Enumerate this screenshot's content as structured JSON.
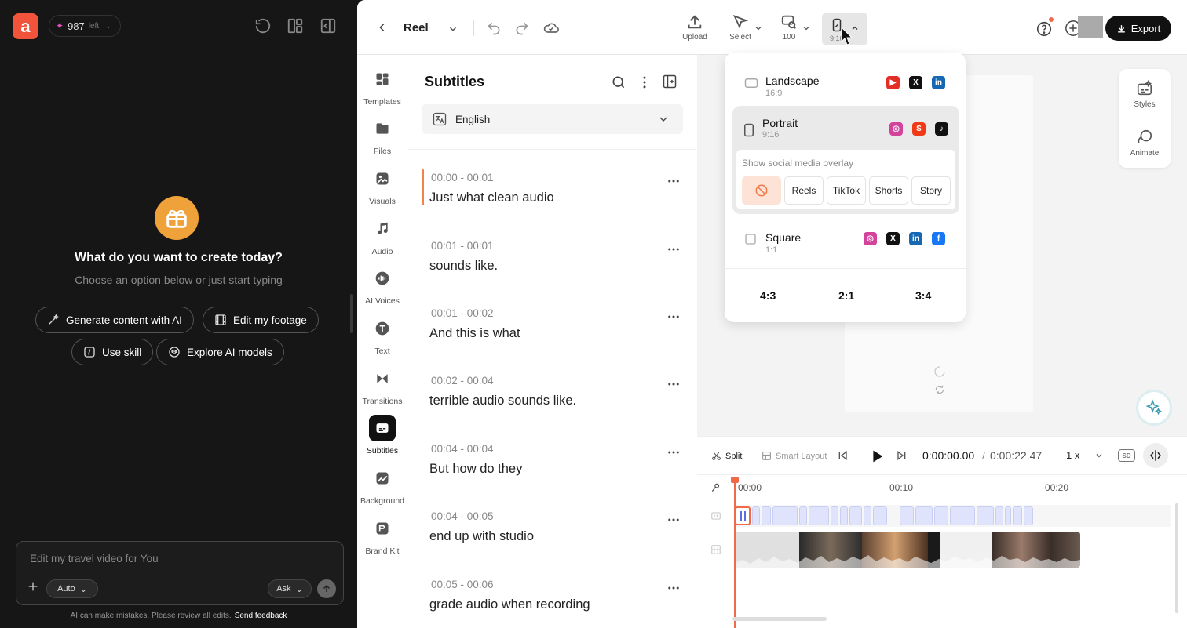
{
  "left_panel": {
    "credits": {
      "count": "987",
      "suffix": "left"
    },
    "hero_title": "What do you want to create today?",
    "hero_subtitle": "Choose an option below or just start typing",
    "actions": [
      "Generate content with AI",
      "Edit my footage",
      "Use skill",
      "Explore AI models"
    ],
    "composer_placeholder": "Edit my travel video for You",
    "mode_label": "Auto",
    "ask_label": "Ask",
    "disclaimer": "AI can make mistakes. Please review all edits.",
    "feedback_link": "Send feedback"
  },
  "topbar": {
    "project_title": "Reel",
    "tools": {
      "upload": "Upload",
      "select": "Select",
      "zoom": "100",
      "ratio": "9:16"
    },
    "export_label": "Export"
  },
  "sidebar": {
    "items": [
      "Templates",
      "Files",
      "Visuals",
      "Audio",
      "AI Voices",
      "Text",
      "Transitions",
      "Subtitles",
      "Background",
      "Brand Kit"
    ],
    "active": "Subtitles"
  },
  "subtitles": {
    "title": "Subtitles",
    "language": "English",
    "entries": [
      {
        "time": "00:00 - 00:01",
        "text": "Just what clean audio"
      },
      {
        "time": "00:01 - 00:01",
        "text": "sounds like."
      },
      {
        "time": "00:01 - 00:02",
        "text": "And this is what"
      },
      {
        "time": "00:02 - 00:04",
        "text": "terrible audio sounds like."
      },
      {
        "time": "00:04 - 00:04",
        "text": "But how do they"
      },
      {
        "time": "00:04 - 00:05",
        "text": "end up with studio"
      },
      {
        "time": "00:05 - 00:06",
        "text": "grade audio when recording"
      }
    ]
  },
  "ratio_menu": {
    "landscape": {
      "name": "Landscape",
      "ratio": "16:9"
    },
    "portrait": {
      "name": "Portrait",
      "ratio": "9:16"
    },
    "overlay_label": "Show social media overlay",
    "overlays": [
      "Reels",
      "TikTok",
      "Shorts",
      "Story"
    ],
    "square": {
      "name": "Square",
      "ratio": "1:1"
    },
    "extra_ratios": [
      "4:3",
      "2:1",
      "3:4"
    ]
  },
  "right_tools": {
    "styles": "Styles",
    "animate": "Animate"
  },
  "player": {
    "split": "Split",
    "smart_layout": "Smart Layout",
    "current_time": "0:00:00.00",
    "separator": "/",
    "total_time": "0:00:22.47",
    "speed": "1 x",
    "quality": "SD"
  },
  "timeline": {
    "ticks": [
      "00:00",
      "00:10",
      "00:20"
    ]
  },
  "colors": {
    "accent": "#f06a4a",
    "subtitle_chip": "#dfe3fb",
    "dark_bg": "#161616"
  }
}
